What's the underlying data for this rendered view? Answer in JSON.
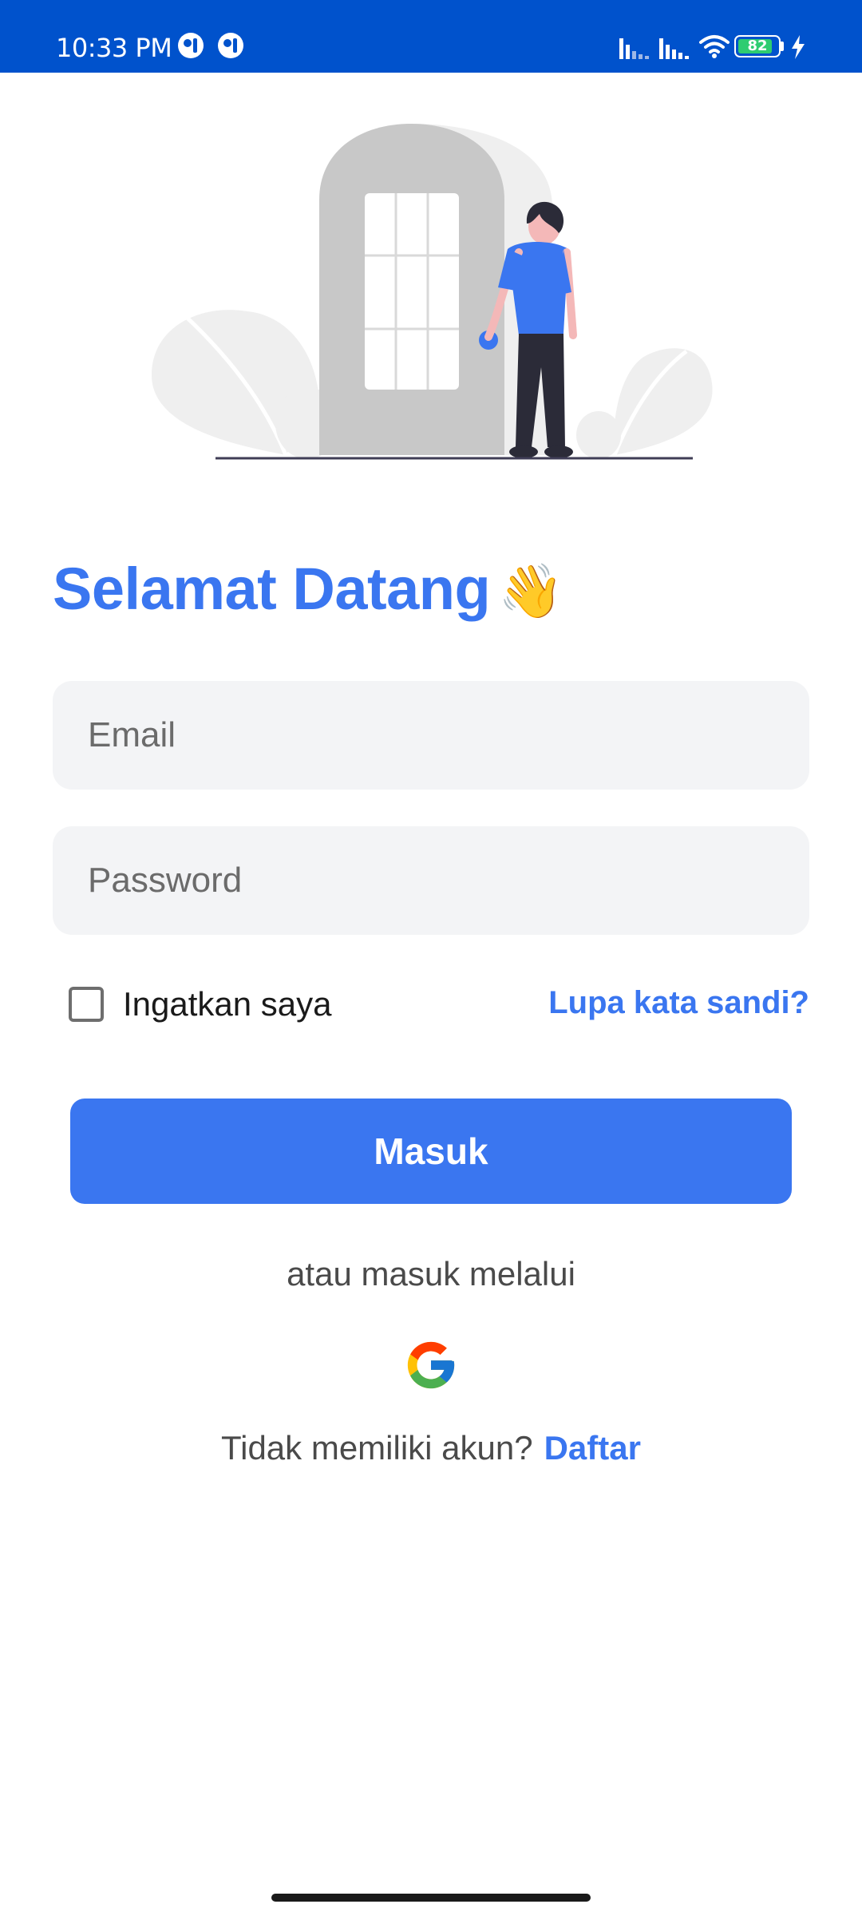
{
  "status_bar": {
    "time": "10:33 PM",
    "battery_level": "82",
    "icons": [
      "app-notification-icon",
      "app-notification-icon",
      "signal-icon",
      "signal-icon",
      "wifi-icon",
      "battery-icon",
      "charging-icon"
    ]
  },
  "colors": {
    "status_bar": "#0052CC",
    "accent": "#3A76F0",
    "field_bg": "#F3F4F6",
    "text_muted": "#4a4a4a"
  },
  "login": {
    "title": "Selamat Datang",
    "title_emoji": "👋",
    "email_placeholder": "Email",
    "password_placeholder": "Password",
    "remember_label": "Ingatkan saya",
    "forgot_link": "Lupa kata sandi?",
    "submit_label": "Masuk",
    "alt_login_text": "atau masuk melalui",
    "signup_prompt": "Tidak memiliki akun?",
    "signup_link": "Daftar"
  }
}
